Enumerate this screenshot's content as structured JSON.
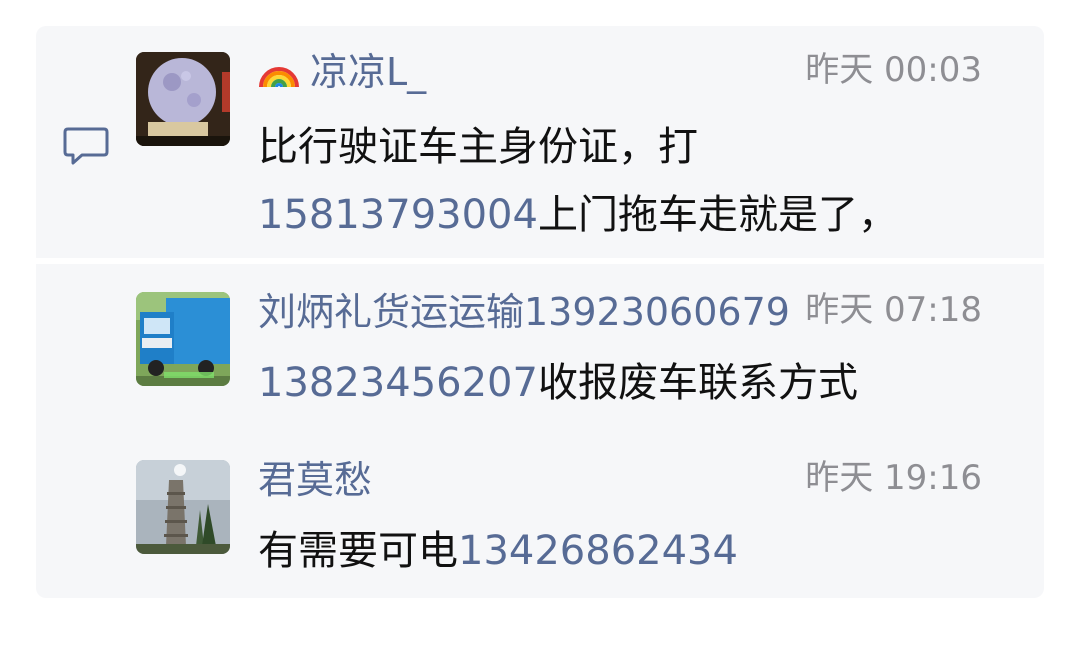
{
  "comments": [
    {
      "name": "凉凉L_",
      "time": "昨天 00:03",
      "text_line1": "比行驶证车主身份证，打",
      "phone": "15813793004",
      "text_line2_rest": "上门拖车走就是了，"
    },
    {
      "name": "刘炳礼货运运输13923060679",
      "time": "昨天 07:18",
      "phone": "13823456207",
      "text_rest": "收报废车联系方式"
    },
    {
      "name": "君莫愁",
      "time": "昨天 19:16",
      "text_prefix": "有需要可电",
      "phone": "13426862434"
    }
  ],
  "icons": {
    "comment": "comment-bubble-icon",
    "rainbow": "rainbow-emoji-icon"
  },
  "colors": {
    "name_link": "#576b95",
    "time": "#8e8e93",
    "text": "#111111",
    "panel_bg": "#f6f7f9"
  }
}
